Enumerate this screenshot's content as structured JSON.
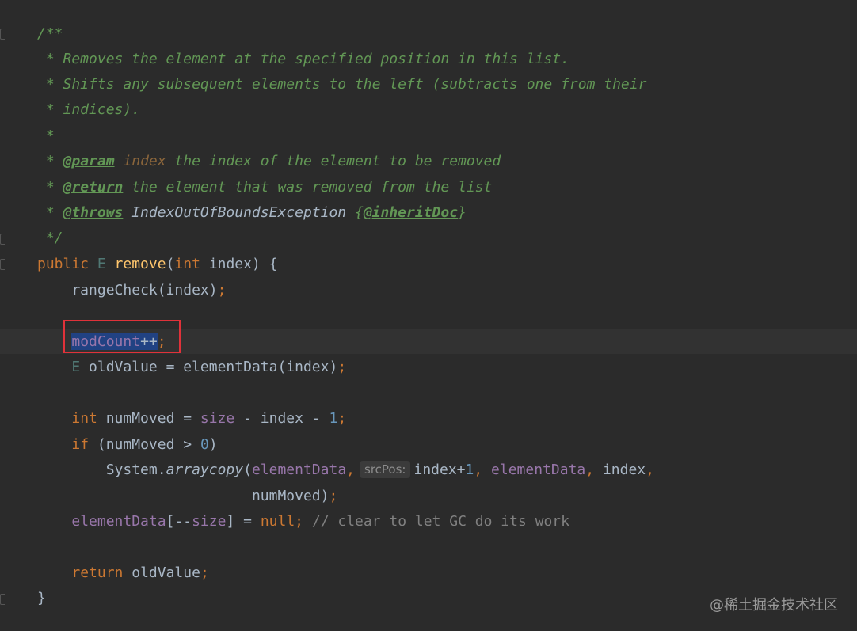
{
  "code": {
    "doc_open": "/**",
    "doc_line1": " * Removes the element at the specified position in this list.",
    "doc_line2": " * Shifts any subsequent elements to the left (subtracts one from their",
    "doc_line3": " * indices).",
    "doc_line4": " *",
    "doc_star": " * ",
    "param_tag": "@param",
    "param_name": "index",
    "param_desc": " the index of the element to be removed",
    "return_tag": "@return",
    "return_desc": " the element that was removed from the list",
    "throws_tag": "@throws",
    "throws_ex": " IndexOutOfBoundsException ",
    "inherit_open": "{",
    "inherit_tag": "@inheritDoc",
    "inherit_close": "}",
    "doc_close": " */",
    "sig_public": "public ",
    "sig_E": "E ",
    "sig_method": "remove",
    "sig_open": "(",
    "sig_int": "int",
    "sig_rest": " index) {",
    "l_rangecheck": "    rangeCheck(index)",
    "semi": ";",
    "indent4": "    ",
    "modcount": "modCount",
    "plusplus": "++",
    "old_E": "E",
    "old_rest": " oldValue = elementData(index)",
    "int_kw": "int",
    "nm_decl": " numMoved = ",
    "size": "size",
    "nm_minus": " - index - ",
    "one": "1",
    "if_kw": "if",
    "if_rest": " (numMoved > ",
    "zero": "0",
    "if_close": ")",
    "indent8": "        ",
    "system": "System.",
    "arraycopy": "arraycopy",
    "ac_open": "(",
    "elementData": "elementData",
    "comma": ",",
    "srcpos_hint": "srcPos:",
    "index_plus": "index+",
    "index_tail": " index",
    "indent25": "                         ",
    "nummoved": "numMoved)",
    "ed_bracket": "[--",
    "ed_close": "] = ",
    "null_kw": "null",
    "gc_comment": " // clear to let GC do its work",
    "return_kw": "return",
    "return_rest": " oldValue",
    "close_brace": "}"
  },
  "watermark": "@稀土掘金技术社区"
}
